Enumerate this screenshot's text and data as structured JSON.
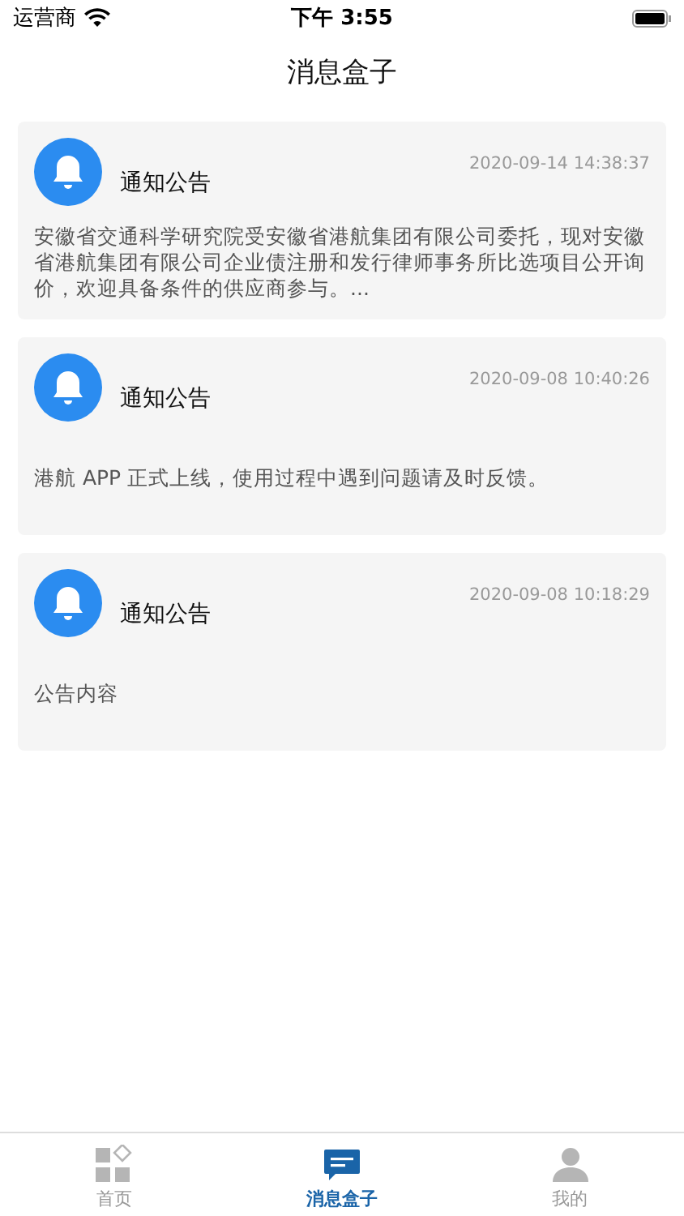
{
  "status_bar": {
    "carrier": "运营商",
    "time": "下午 3:55"
  },
  "nav": {
    "title": "消息盒子"
  },
  "messages": [
    {
      "title": "通知公告",
      "time": "2020-09-14 14:38:37",
      "body": "安徽省交通科学研究院受安徽省港航集团有限公司委托，现对安徽省港航集团有限公司企业债注册和发行律师事务所比选项目公开询价，欢迎具备条件的供应商参与。..."
    },
    {
      "title": "通知公告",
      "time": "2020-09-08 10:40:26",
      "body": "港航 APP 正式上线，使用过程中遇到问题请及时反馈。"
    },
    {
      "title": "通知公告",
      "time": "2020-09-08 10:18:29",
      "body": "公告内容"
    }
  ],
  "tabs": [
    {
      "kind": "home",
      "label": "首页",
      "selected": false
    },
    {
      "kind": "messages",
      "label": "消息盒子",
      "selected": true
    },
    {
      "kind": "profile",
      "label": "我的",
      "selected": false
    }
  ]
}
